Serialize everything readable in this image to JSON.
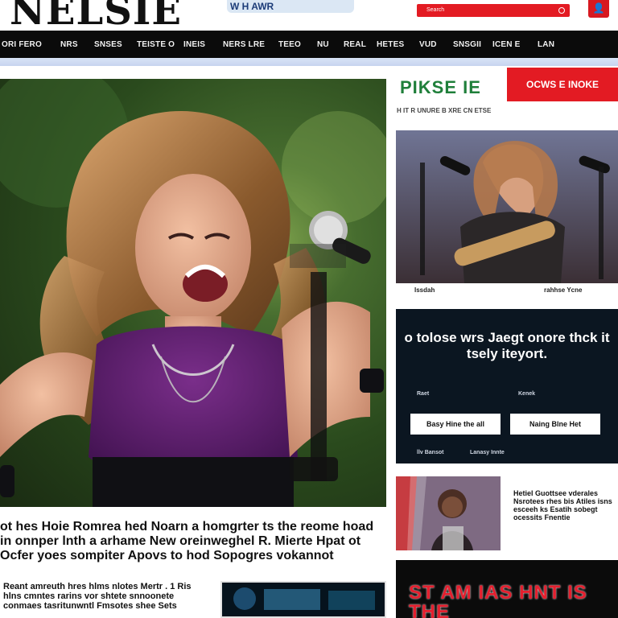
{
  "header": {
    "logo_text": "NELSIE",
    "logo_badge": "W H AWR",
    "search_placeholder": "Search",
    "user_icon": "user-icon"
  },
  "nav": {
    "items": [
      "ORI FERO",
      "NRS",
      "SNSES",
      "TEISTE O",
      "INEIS",
      "NERS LRE",
      "TEEO",
      "NU",
      "REAL",
      "HETES",
      "VUD",
      "SNSGII",
      "ICEN E",
      "LAN"
    ]
  },
  "hero": {
    "headline": "ot hes Hoie Romrea hed Noarn a homgrter ts the reome hoad in onnper lnth a arhame New oreinweghel R. Mierte Hpat ot Ocfer yoes sompiter Apovs to hod Sopogres vokannot",
    "body": "Reant amreuth hres hlms nlotes Mertr . 1 Ris hlns cmntes rarins vor shtete snnoonete conmaes tasritunwntl Fmsotes shee Sets"
  },
  "rail": {
    "title": "PIKSE IE",
    "subtitle": "H IT R UNURE B XRE CN ETSE",
    "cta_label": "OCWS E INOKE",
    "card1_caption_left": "Issdah",
    "card1_caption_right": "rahhse Ycne",
    "promo_title": "o tolose wrs Jaegt onore thck it tsely iteyort.",
    "promo_label_left": "Raet",
    "promo_label_right": "Kenek",
    "promo_btn_left": "Basy Hine the all",
    "promo_btn_right": "Naing Blne Het",
    "promo_foot_left": "llv Bansot",
    "promo_foot_right": "Lanasy Innte",
    "card3_text": "Hetiel Guottsee vderales Nsrotees rhes bis Atiles isns esceeh ks Esatih sobegt ocessits Fnentie",
    "banner_text": "ST AM IAS HNT IS THE"
  }
}
